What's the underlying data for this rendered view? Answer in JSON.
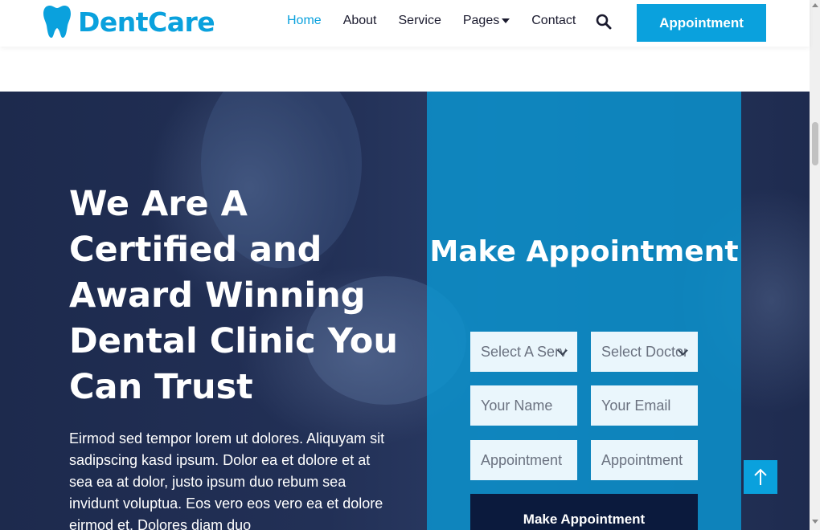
{
  "brand": {
    "name": "DentCare",
    "icon": "tooth-icon",
    "color": "#0aa1dd"
  },
  "nav": {
    "items": [
      {
        "label": "Home",
        "active": true
      },
      {
        "label": "About",
        "active": false
      },
      {
        "label": "Service",
        "active": false
      },
      {
        "label": "Pages",
        "active": false,
        "dropdown": true
      },
      {
        "label": "Contact",
        "active": false
      }
    ],
    "search_icon": "search-icon",
    "appointment_label": "Appointment"
  },
  "hero": {
    "title": "We Are A Certified and Award Winning Dental Clinic You Can Trust",
    "text": "Eirmod sed tempor lorem ut dolores. Aliquyam sit sadipscing kasd ipsum. Dolor ea et dolore et at sea ea at dolor, justo ipsum duo rebum sea invidunt voluptua. Eos vero eos vero ea et dolore eirmod et. Dolores diam duo"
  },
  "appointment_form": {
    "title": "Make Appointment",
    "service_select": "Select A Service",
    "doctor_select": "Select Doctor",
    "name_placeholder": "Your Name",
    "email_placeholder": "Your Email",
    "date_placeholder": "Appointment Date",
    "time_placeholder": "Appointment Time",
    "submit_label": "Make Appointment"
  },
  "colors": {
    "primary": "#0aa1dd",
    "dark": "#0b1a3d",
    "hero_overlay": "#223056"
  }
}
